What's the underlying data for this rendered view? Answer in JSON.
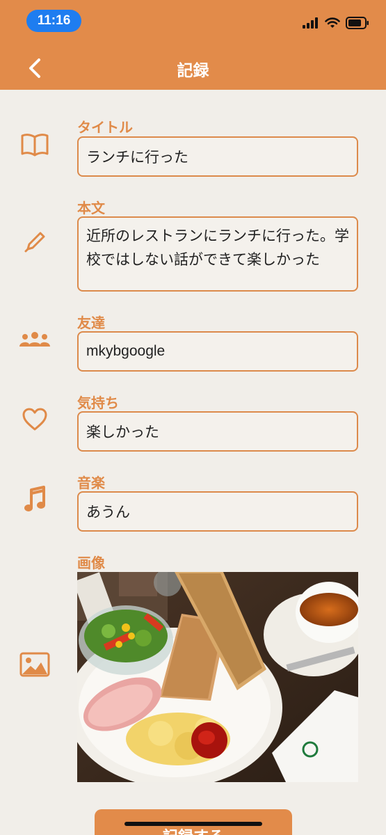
{
  "status_bar": {
    "time": "11:16"
  },
  "header": {
    "title": "記録"
  },
  "fields": {
    "title": {
      "label": "タイトル",
      "value": "ランチに行った"
    },
    "body": {
      "label": "本文",
      "value": "近所のレストランにランチに行った。学校ではしない話ができて楽しかった"
    },
    "friend": {
      "label": "友達",
      "value": "mkybgoogle"
    },
    "feeling": {
      "label": "気持ち",
      "value": "楽しかった"
    },
    "music": {
      "label": "音楽",
      "value": "あうん"
    },
    "image": {
      "label": "画像"
    }
  },
  "save_button": {
    "label": "記録する"
  },
  "icons": {
    "back": "chevron-left-icon",
    "title": "book-icon",
    "body": "pencil-icon",
    "friend": "people-icon",
    "feeling": "heart-icon",
    "music": "music-note-icon",
    "image": "image-icon"
  },
  "colors": {
    "accent": "#e28b4a",
    "background": "#f1eee9",
    "status_pill": "#1e7df0"
  }
}
